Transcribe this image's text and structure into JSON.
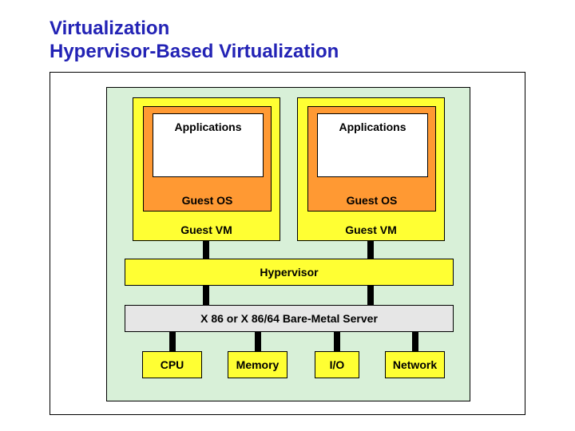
{
  "title_line1": "Virtualization",
  "title_line2": "Hypervisor-Based Virtualization",
  "vm_stacks": [
    {
      "apps": "Applications",
      "guest_os": "Guest OS",
      "guest_vm": "Guest VM"
    },
    {
      "apps": "Applications",
      "guest_os": "Guest OS",
      "guest_vm": "Guest VM"
    }
  ],
  "hypervisor": "Hypervisor",
  "server": "X 86 or X 86/64 Bare-Metal Server",
  "hardware": {
    "cpu": "CPU",
    "memory": "Memory",
    "io": "I/O",
    "network": "Network"
  }
}
